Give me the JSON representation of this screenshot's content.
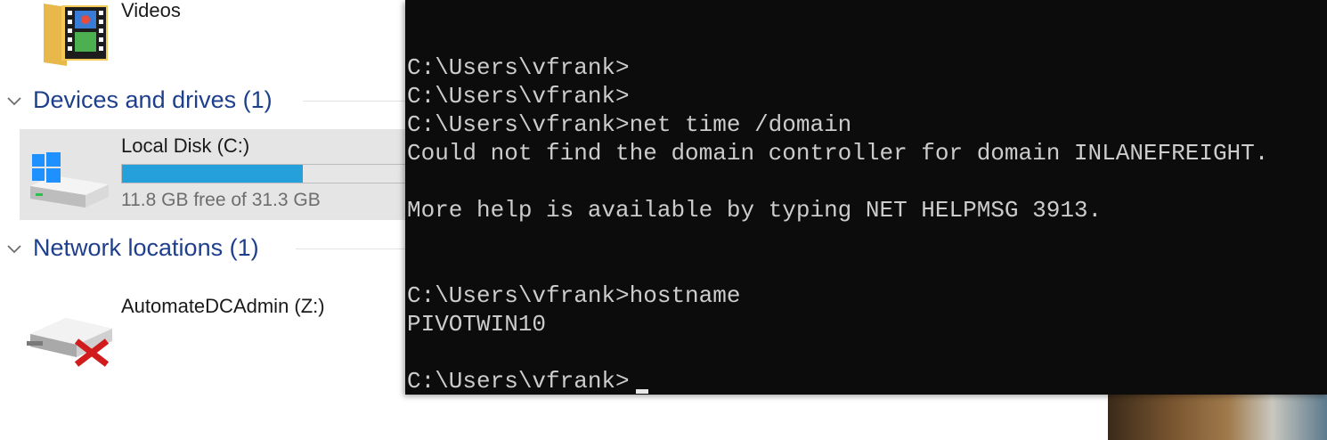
{
  "explorer": {
    "top_folder": {
      "label": "Videos",
      "icon": "videos-folder-icon"
    },
    "groups": [
      {
        "title": "Devices and drives (1)",
        "items": [
          {
            "label": "Local Disk (C:)",
            "detail": "11.8 GB free of 31.3 GB",
            "usage_fraction": 0.62,
            "icon": "windows-drive-icon"
          }
        ]
      },
      {
        "title": "Network locations (1)",
        "items": [
          {
            "label": "AutomateDCAdmin (Z:)",
            "icon": "disconnected-network-drive-icon"
          }
        ]
      }
    ]
  },
  "terminal": {
    "lines": [
      "C:\\Users\\vfrank>",
      "C:\\Users\\vfrank>",
      "C:\\Users\\vfrank>net time /domain",
      "Could not find the domain controller for domain INLANEFREIGHT.",
      "",
      "More help is available by typing NET HELPMSG 3913.",
      "",
      "",
      "C:\\Users\\vfrank>hostname",
      "PIVOTWIN10",
      "",
      "C:\\Users\\vfrank>"
    ]
  },
  "colors": {
    "group_header": "#1e3f8c",
    "drive_bar": "#26a0da",
    "terminal_bg": "#0c0c0c",
    "terminal_text": "#cccccc",
    "error_x": "#d01c1c"
  }
}
